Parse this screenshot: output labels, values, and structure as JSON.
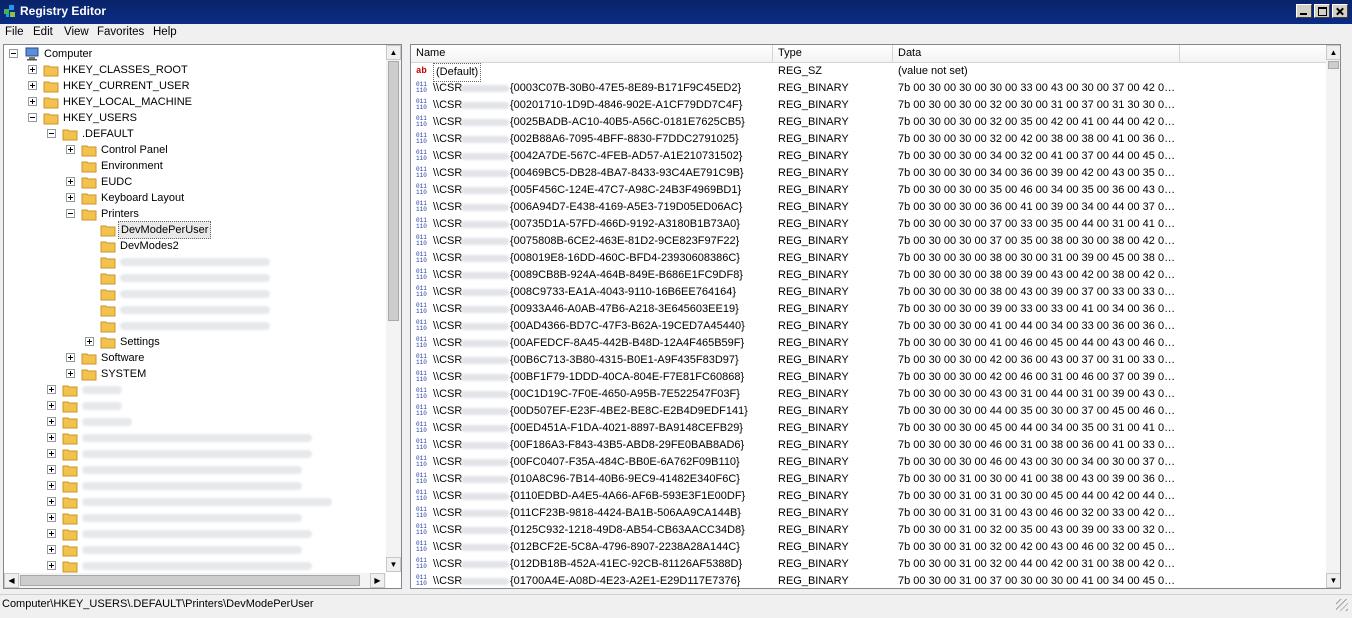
{
  "window": {
    "title": "Registry Editor"
  },
  "menu": [
    "File",
    "Edit",
    "View",
    "Favorites",
    "Help"
  ],
  "tree": {
    "root": "Computer",
    "hives": [
      "HKEY_CLASSES_ROOT",
      "HKEY_CURRENT_USER",
      "HKEY_LOCAL_MACHINE",
      "HKEY_USERS"
    ],
    "default_key": ".DEFAULT",
    "default_children": [
      "Control Panel",
      "Environment",
      "EUDC",
      "Keyboard Layout",
      "Printers"
    ],
    "printers_children": [
      "DevModePerUser",
      "DevModes2",
      "Settings"
    ],
    "after_printers": [
      "Software",
      "SYSTEM"
    ]
  },
  "list": {
    "columns": [
      "Name",
      "Type",
      "Data"
    ],
    "rows": [
      {
        "name": "(Default)",
        "type": "REG_SZ",
        "data": "(value not set)",
        "icon": "string"
      },
      {
        "name": "\\\\CSR",
        "guid": "{0003C07B-30B0-47E5-8E89-B171F9C45ED2}",
        "type": "REG_BINARY",
        "data": "7b 00 30 00 30 00 30 00 33 00 43 00 30 00 37 00 42 0…"
      },
      {
        "name": "\\\\CSR",
        "guid": "{00201710-1D9D-4846-902E-A1CF79DD7C4F}",
        "type": "REG_BINARY",
        "data": "7b 00 30 00 30 00 32 00 30 00 31 00 37 00 31 30 30 0…"
      },
      {
        "name": "\\\\CSR",
        "guid": "{0025BADB-AC10-40B5-A56C-0181E7625CB5}",
        "type": "REG_BINARY",
        "data": "7b 00 30 00 30 00 32 00 35 00 42 00 41 00 44 00 42 0…"
      },
      {
        "name": "\\\\CSR",
        "guid": "{002B88A6-7095-4BFF-8830-F7DDC2791025}",
        "type": "REG_BINARY",
        "data": "7b 00 30 00 30 00 32 00 42 00 38 00 38 00 41 00 36 0…"
      },
      {
        "name": "\\\\CSR",
        "guid": "{0042A7DE-567C-4FEB-AD57-A1E210731502}",
        "type": "REG_BINARY",
        "data": "7b 00 30 00 30 00 34 00 32 00 41 00 37 00 44 00 45 0…"
      },
      {
        "name": "\\\\CSR",
        "guid": "{00469BC5-DB28-4BA7-8433-93C4AE791C9B}",
        "type": "REG_BINARY",
        "data": "7b 00 30 00 30 00 34 00 36 00 39 00 42 00 43 00 35 0…"
      },
      {
        "name": "\\\\CSR",
        "guid": "{005F456C-124E-47C7-A98C-24B3F4969BD1}",
        "type": "REG_BINARY",
        "data": "7b 00 30 00 30 00 35 00 46 00 34 00 35 00 36 00 43 0…"
      },
      {
        "name": "\\\\CSR",
        "guid": "{006A94D7-E438-4169-A5E3-719D05ED06AC}",
        "type": "REG_BINARY",
        "data": "7b 00 30 00 30 00 36 00 41 00 39 00 34 00 44 00 37 0…"
      },
      {
        "name": "\\\\CSR",
        "guid": "{00735D1A-57FD-466D-9192-A3180B1B73A0}",
        "type": "REG_BINARY",
        "data": "7b 00 30 00 30 00 37 00 33 00 35 00 44 00 31 00 41 0…"
      },
      {
        "name": "\\\\CSR",
        "guid": "{0075808B-6CE2-463E-81D2-9CE823F97F22}",
        "type": "REG_BINARY",
        "data": "7b 00 30 00 30 00 37 00 35 00 38 00 30 00 38 00 42 0…"
      },
      {
        "name": "\\\\CSR",
        "guid": "{008019E8-16DD-460C-BFD4-23930608386C}",
        "type": "REG_BINARY",
        "data": "7b 00 30 00 30 00 38 00 30 00 31 00 39 00 45 00 38 0…"
      },
      {
        "name": "\\\\CSR",
        "guid": "{0089CB8B-924A-464B-849E-B686E1FC9DF8}",
        "type": "REG_BINARY",
        "data": "7b 00 30 00 30 00 38 00 39 00 43 00 42 00 38 00 42 0…"
      },
      {
        "name": "\\\\CSR",
        "guid": "{008C9733-EA1A-4043-9110-16B6EE764164}",
        "type": "REG_BINARY",
        "data": "7b 00 30 00 30 00 38 00 43 00 39 00 37 00 33 00 33 0…"
      },
      {
        "name": "\\\\CSR",
        "guid": "{00933A46-A0AB-47B6-A218-3E645603EE19}",
        "type": "REG_BINARY",
        "data": "7b 00 30 00 30 00 39 00 33 00 33 00 41 00 34 00 36 0…"
      },
      {
        "name": "\\\\CSR",
        "guid": "{00AD4366-BD7C-47F3-B62A-19CED7A45440}",
        "type": "REG_BINARY",
        "data": "7b 00 30 00 30 00 41 00 44 00 34 00 33 00 36 00 36 0…"
      },
      {
        "name": "\\\\CSR",
        "guid": "{00AFEDCF-8A45-442B-B48D-12A4F465B59F}",
        "type": "REG_BINARY",
        "data": "7b 00 30 00 30 00 41 00 46 00 45 00 44 00 43 00 46 0…"
      },
      {
        "name": "\\\\CSR",
        "guid": "{00B6C713-3B80-4315-B0E1-A9F435F83D97}",
        "type": "REG_BINARY",
        "data": "7b 00 30 00 30 00 42 00 36 00 43 00 37 00 31 00 33 0…"
      },
      {
        "name": "\\\\CSR",
        "guid": "{00BF1F79-1DDD-40CA-804E-F7E81FC60868}",
        "type": "REG_BINARY",
        "data": "7b 00 30 00 30 00 42 00 46 00 31 00 46 00 37 00 39 0…"
      },
      {
        "name": "\\\\CSR",
        "guid": "{00C1D19C-7F0E-4650-A95B-7E522547F03F}",
        "type": "REG_BINARY",
        "data": "7b 00 30 00 30 00 43 00 31 00 44 00 31 00 39 00 43 0…"
      },
      {
        "name": "\\\\CSR",
        "guid": "{00D507EF-E23F-4BE2-BE8C-E2B4D9EDF141}",
        "type": "REG_BINARY",
        "data": "7b 00 30 00 30 00 44 00 35 00 30 00 37 00 45 00 46 0…"
      },
      {
        "name": "\\\\CSR",
        "guid": "{00ED451A-F1DA-4021-8897-BA9148CEFB29}",
        "type": "REG_BINARY",
        "data": "7b 00 30 00 30 00 45 00 44 00 34 00 35 00 31 00 41 0…"
      },
      {
        "name": "\\\\CSR",
        "guid": "{00F186A3-F843-43B5-ABD8-29FE0BAB8AD6}",
        "type": "REG_BINARY",
        "data": "7b 00 30 00 30 00 46 00 31 00 38 00 36 00 41 00 33 0…"
      },
      {
        "name": "\\\\CSR",
        "guid": "{00FC0407-F35A-484C-BB0E-6A762F09B110}",
        "type": "REG_BINARY",
        "data": "7b 00 30 00 30 00 46 00 43 00 30 00 34 00 30 00 37 0…"
      },
      {
        "name": "\\\\CSR",
        "guid": "{010A8C96-7B14-40B6-9EC9-41482E340F6C}",
        "type": "REG_BINARY",
        "data": "7b 00 30 00 31 00 30 00 41 00 38 00 43 00 39 00 36 0…"
      },
      {
        "name": "\\\\CSR",
        "guid": "{0110EDBD-A4E5-4A66-AF6B-593E3F1E00DF}",
        "type": "REG_BINARY",
        "data": "7b 00 30 00 31 00 31 00 30 00 45 00 44 00 42 00 44 0…"
      },
      {
        "name": "\\\\CSR",
        "guid": "{011CF23B-9818-4424-BA1B-506AA9CA144B}",
        "type": "REG_BINARY",
        "data": "7b 00 30 00 31 00 31 00 43 00 46 00 32 00 33 00 42 0…"
      },
      {
        "name": "\\\\CSR",
        "guid": "{0125C932-1218-49D8-AB54-CB63AACC34D8}",
        "type": "REG_BINARY",
        "data": "7b 00 30 00 31 00 32 00 35 00 43 00 39 00 33 00 32 0…"
      },
      {
        "name": "\\\\CSR",
        "guid": "{012BCF2E-5C8A-4796-8907-2238A28A144C}",
        "type": "REG_BINARY",
        "data": "7b 00 30 00 31 00 32 00 42 00 43 00 46 00 32 00 45 0…"
      },
      {
        "name": "\\\\CSR",
        "guid": "{012DB18B-452A-41EC-92CB-81126AF5388D}",
        "type": "REG_BINARY",
        "data": "7b 00 30 00 31 00 32 00 44 00 42 00 31 00 38 00 42 0…"
      },
      {
        "name": "\\\\CSR",
        "guid": "{01700A4E-A08D-4E23-A2E1-E29D117E7376}",
        "type": "REG_BINARY",
        "data": "7b 00 30 00 31 00 37 00 30 00 30 00 41 00 34 00 45 0…"
      }
    ]
  },
  "status": {
    "path": "Computer\\HKEY_USERS\\.DEFAULT\\Printers\\DevModePerUser"
  },
  "colors": {
    "title_bg": "#0a246a",
    "folder": "#f2c14e",
    "selection": "#e8e8e8"
  }
}
